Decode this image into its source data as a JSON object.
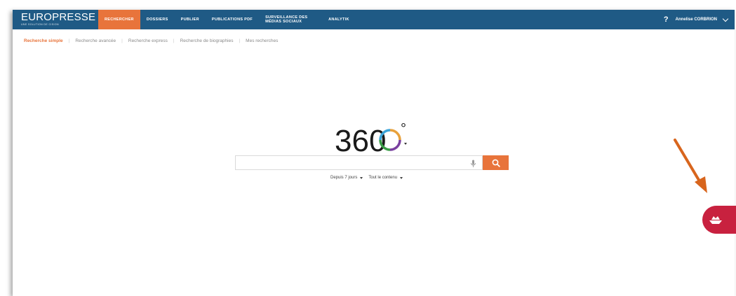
{
  "brand": {
    "name": "EUROPRESSE",
    "tagline": "UNE SOLUTION DE CISION"
  },
  "nav": [
    {
      "label": "RECHERCHER",
      "active": true
    },
    {
      "label": "DOSSIERS",
      "active": false
    },
    {
      "label": "PUBLIER",
      "active": false
    },
    {
      "label": "PUBLICATIONS PDF",
      "active": false
    },
    {
      "label": "SURVEILLANCE DES MÉDIAS SOCIAUX",
      "active": false
    },
    {
      "label": "ANALYTIK",
      "active": false
    }
  ],
  "user": {
    "help_label": "?",
    "name": "Annelise CORBRION"
  },
  "subnav": [
    {
      "label": "Recherche simple",
      "active": true
    },
    {
      "label": "Recherche avancée",
      "active": false
    },
    {
      "label": "Recherche express",
      "active": false
    },
    {
      "label": "Recherche de biographies",
      "active": false
    },
    {
      "label": "Mes recherches",
      "active": false
    }
  ],
  "logo": {
    "text": "360",
    "degree": "°"
  },
  "search": {
    "value": "",
    "placeholder": ""
  },
  "filters": {
    "period": "Depuis 7 jours",
    "content": "Tout le contenu"
  },
  "colors": {
    "topbar": "#1f5a85",
    "accent": "#e8743b",
    "widget": "#c8213f",
    "arrow": "#d8651d"
  },
  "icons": {
    "help": "question-mark-icon",
    "mic": "microphone-icon",
    "search": "magnifier-icon",
    "widget": "boat-icon"
  }
}
